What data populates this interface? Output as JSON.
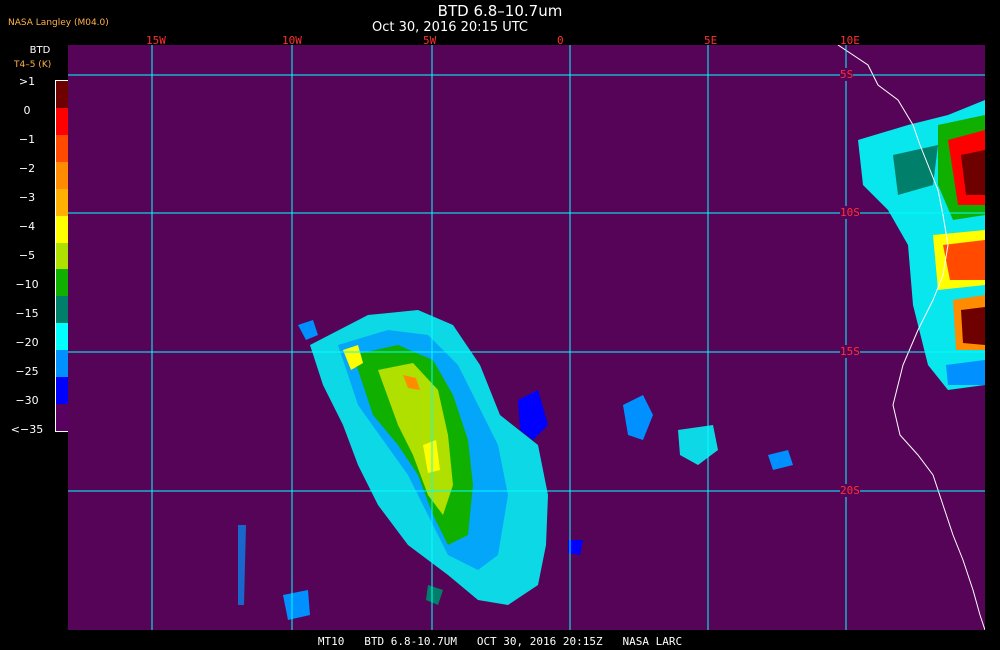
{
  "header": {
    "title": "BTD 6.8–10.7um",
    "subtitle": "Oct 30, 2016 20:15 UTC",
    "source": "NASA Langley (M04.0)"
  },
  "colorbar": {
    "title": "BTD",
    "unit": "T4–5 (K)",
    "labels": [
      ">1",
      "0",
      "−1",
      "−2",
      "−3",
      "−4",
      "−5",
      "−10",
      "−15",
      "−20",
      "−25",
      "−30",
      "<−35"
    ],
    "colors": [
      "#6e0000",
      "#ff0000",
      "#ff4a00",
      "#ff8c00",
      "#ffb000",
      "#ffff00",
      "#b0e000",
      "#10b000",
      "#00806a",
      "#00ffff",
      "#0090ff",
      "#0000ff",
      "#5a0060"
    ]
  },
  "grid": {
    "lon_labels": [
      "15W",
      "10W",
      "5W",
      "0",
      "5E",
      "10E"
    ],
    "lat_labels": [
      "5S",
      "10S",
      "15S",
      "20S"
    ]
  },
  "footer": "MT10   BTD 6.8-10.7UM   OCT 30, 2016 20:15Z   NASA LARC",
  "colors": {
    "background": "#560457",
    "grid": "#00ffff",
    "grid_labels": "#ff3030",
    "coastline": "#ffffff"
  }
}
